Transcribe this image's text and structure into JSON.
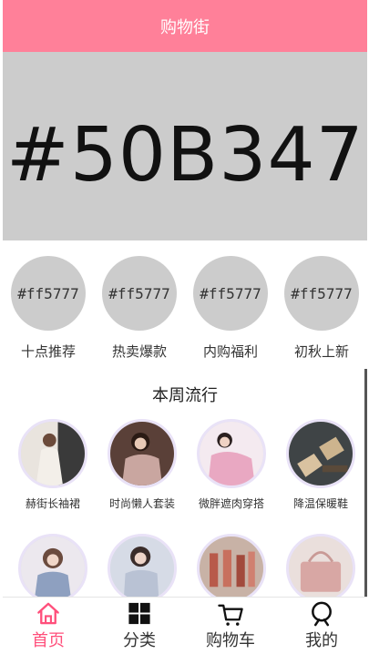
{
  "header": {
    "title": "购物街"
  },
  "banner": {
    "text": "#50B347"
  },
  "shortcuts": [
    {
      "circle_text": "#ff5777",
      "label": "十点推荐"
    },
    {
      "circle_text": "#ff5777",
      "label": "热卖爆款"
    },
    {
      "circle_text": "#ff5777",
      "label": "内购福利"
    },
    {
      "circle_text": "#ff5777",
      "label": "初秋上新"
    }
  ],
  "week": {
    "title": "本周流行",
    "products": [
      {
        "label": "赫街长袖裙"
      },
      {
        "label": "时尚懒人套装"
      },
      {
        "label": "微胖遮肉穿搭"
      },
      {
        "label": "降温保暖鞋"
      },
      {
        "label": ""
      },
      {
        "label": ""
      },
      {
        "label": ""
      },
      {
        "label": ""
      }
    ]
  },
  "tabbar": {
    "active_color": "#ff4f7b",
    "items": [
      {
        "label": "首页",
        "icon": "home-icon",
        "active": true
      },
      {
        "label": "分类",
        "icon": "grid-icon",
        "active": false
      },
      {
        "label": "购物车",
        "icon": "cart-icon",
        "active": false
      },
      {
        "label": "我的",
        "icon": "profile-icon",
        "active": false
      }
    ]
  },
  "colors": {
    "header": "#ff8099",
    "placeholder": "#cccccc"
  }
}
